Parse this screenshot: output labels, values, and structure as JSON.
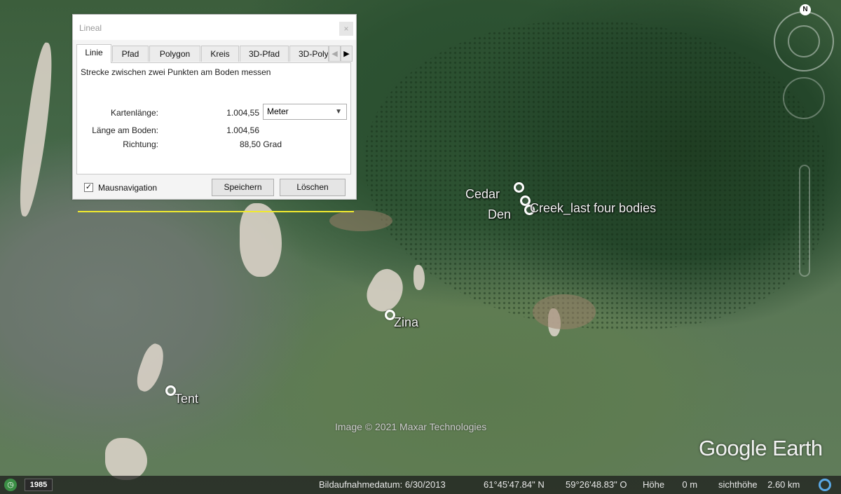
{
  "dialog": {
    "title": "Lineal",
    "close_label": "×",
    "tabs": [
      "Linie",
      "Pfad",
      "Polygon",
      "Kreis",
      "3D-Pfad",
      "3D-Poly"
    ],
    "description": "Strecke zwischen zwei Punkten am Boden messen",
    "map_length_label": "Kartenlänge:",
    "map_length_value": "1.004,55",
    "ground_length_label": "Länge am Boden:",
    "ground_length_value": "1.004,56",
    "direction_label": "Richtung:",
    "direction_value": "88,50 Grad",
    "unit_selected": "Meter",
    "mouse_nav_label": "Mausnavigation",
    "mouse_nav_checked": true,
    "save_label": "Speichern",
    "delete_label": "Löschen"
  },
  "map": {
    "placemarks": [
      "Cedar",
      "Den",
      "Creek_last four bodies",
      "Zina",
      "Tent"
    ],
    "credit": "Image © 2021 Maxar Technologies",
    "logo": "Google Earth",
    "north_label": "N",
    "measure_line_color": "#f1ea2e"
  },
  "statusbar": {
    "year": "1985",
    "imagery_date": "Bildaufnahmedatum: 6/30/2013",
    "latitude": "61°45'47.84\" N",
    "longitude": "59°26'48.83\" O",
    "elevation": "Höhe       0 m",
    "eye_alt": "sichthöhe    2.60 km"
  },
  "icons": [
    "clock-icon",
    "compass-icon",
    "north-icon",
    "checkbox-icon",
    "dropdown-caret-icon",
    "busy-icon",
    "placemark-icon"
  ]
}
